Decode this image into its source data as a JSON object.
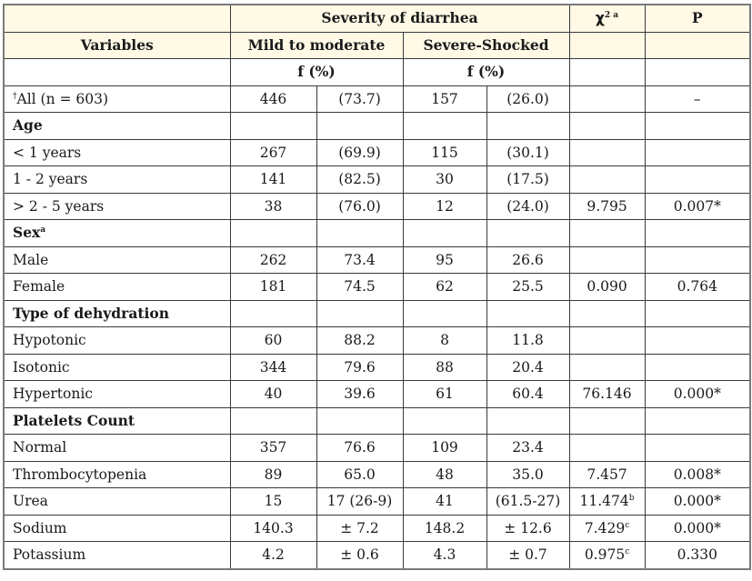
{
  "table": {
    "header": {
      "severity_title": "Severity of diarrhea",
      "chi_label": "χ",
      "chi_sup": "2 a",
      "p_label": "P",
      "variables_label": "Variables",
      "mild_label": "Mild to moderate",
      "severe_label": "Severe-Shocked",
      "mild_unit": "f (%)",
      "severe_unit": "f (%)"
    },
    "all_row": {
      "prefix_sup": "†",
      "label": "All (n = 603)",
      "mild_f": "446",
      "mild_pct": "(73.7)",
      "severe_f": "157",
      "severe_pct": "(26.0)",
      "chi": "",
      "p": "–"
    },
    "sections": [
      {
        "title": "Age",
        "title_sup": "",
        "rows": [
          {
            "label": "< 1 years",
            "mild_f": "267",
            "mild_pct": "(69.9)",
            "severe_f": "115",
            "severe_pct": "(30.1)",
            "chi": "",
            "chi_sup": "",
            "p": ""
          },
          {
            "label": "1 - 2 years",
            "mild_f": "141",
            "mild_pct": "(82.5)",
            "severe_f": "30",
            "severe_pct": "(17.5)",
            "chi": "",
            "chi_sup": "",
            "p": ""
          },
          {
            "label": "> 2 - 5 years",
            "mild_f": "38",
            "mild_pct": "(76.0)",
            "severe_f": "12",
            "severe_pct": "(24.0)",
            "chi": "9.795",
            "chi_sup": "",
            "p": "0.007*"
          }
        ]
      },
      {
        "title": "Sex",
        "title_sup": "a",
        "rows": [
          {
            "label": "Male",
            "mild_f": "262",
            "mild_pct": "73.4",
            "severe_f": "95",
            "severe_pct": "26.6",
            "chi": "",
            "chi_sup": "",
            "p": ""
          },
          {
            "label": "Female",
            "mild_f": "181",
            "mild_pct": "74.5",
            "severe_f": "62",
            "severe_pct": "25.5",
            "chi": "0.090",
            "chi_sup": "",
            "p": "0.764"
          }
        ]
      },
      {
        "title": "Type of dehydration",
        "title_sup": "",
        "rows": [
          {
            "label": "Hypotonic",
            "mild_f": "60",
            "mild_pct": "88.2",
            "severe_f": "8",
            "severe_pct": "11.8",
            "chi": "",
            "chi_sup": "",
            "p": ""
          },
          {
            "label": "Isotonic",
            "mild_f": "344",
            "mild_pct": "79.6",
            "severe_f": "88",
            "severe_pct": "20.4",
            "chi": "",
            "chi_sup": "",
            "p": ""
          },
          {
            "label": "Hypertonic",
            "mild_f": "40",
            "mild_pct": "39.6",
            "severe_f": "61",
            "severe_pct": "60.4",
            "chi": "76.146",
            "chi_sup": "",
            "p": "0.000*"
          }
        ]
      },
      {
        "title": "Platelets Count",
        "title_sup": "",
        "rows": [
          {
            "label": "Normal",
            "mild_f": "357",
            "mild_pct": "76.6",
            "severe_f": "109",
            "severe_pct": "23.4",
            "chi": "",
            "chi_sup": "",
            "p": ""
          },
          {
            "label": "Thrombocytopenia",
            "mild_f": "89",
            "mild_pct": "65.0",
            "severe_f": "48",
            "severe_pct": "35.0",
            "chi": "7.457",
            "chi_sup": "",
            "p": "0.008*"
          }
        ]
      }
    ],
    "extra_rows": [
      {
        "label": "Urea",
        "mild_f": "15",
        "mild_pct": "17 (26-9)",
        "severe_f": "41",
        "severe_pct": "(61.5-27)",
        "chi": "11.474",
        "chi_sup": "b",
        "p": "0.000*"
      },
      {
        "label": "Sodium",
        "mild_f": "140.3",
        "mild_pct": "± 7.2",
        "severe_f": "148.2",
        "severe_pct": "± 12.6",
        "chi": "7.429",
        "chi_sup": "c",
        "p": "0.000*"
      },
      {
        "label": "Potassium",
        "mild_f": "4.2",
        "mild_pct": "± 0.6",
        "severe_f": "4.3",
        "severe_pct": "± 0.7",
        "chi": "0.975",
        "chi_sup": "c",
        "p": "0.330"
      }
    ]
  }
}
